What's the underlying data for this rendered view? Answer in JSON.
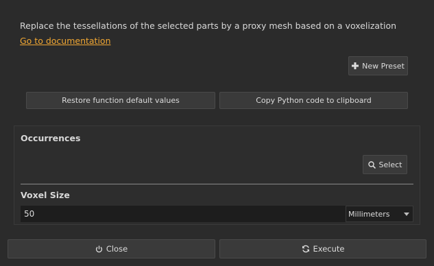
{
  "description": "Replace the tessellations of the selected parts by a proxy mesh based on a voxelization",
  "doc_link": "Go to documentation",
  "toolbar": {
    "new_preset_label": "New Preset",
    "new_preset_icon": "plus-icon",
    "restore_label": "Restore function default values",
    "copy_label": "Copy Python code to clipboard"
  },
  "occurrences": {
    "title": "Occurrences",
    "select_label": "Select",
    "select_icon": "search-icon"
  },
  "voxel_size": {
    "title": "Voxel Size",
    "value": "50",
    "unit": "Millimeters"
  },
  "footer": {
    "close_label": "Close",
    "close_icon": "power-icon",
    "execute_label": "Execute",
    "execute_icon": "refresh-icon"
  },
  "colors": {
    "background": "#2b2b2b",
    "link": "#f0a733",
    "button": "#3a3a3a",
    "input": "#1d1d1d"
  }
}
